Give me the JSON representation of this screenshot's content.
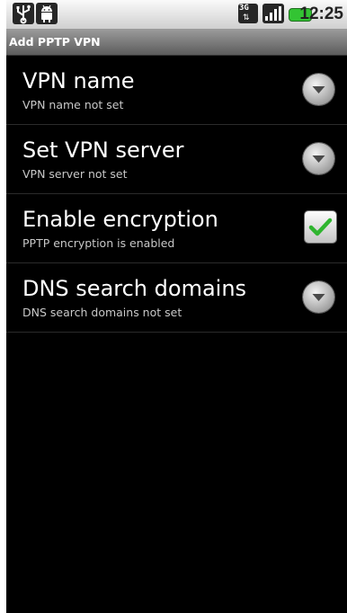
{
  "status_bar": {
    "time": "12:25",
    "network_type": "3G",
    "signal_bars": 4,
    "battery_color": "#33c433",
    "icons": [
      "usb-icon",
      "android-notification-icon",
      "3g-data-icon",
      "signal-strength-icon",
      "battery-icon"
    ]
  },
  "title_bar": {
    "title": "Add PPTP VPN"
  },
  "preferences": [
    {
      "title": "VPN name",
      "summary": "VPN name not set",
      "widget": "dropdown-arrow-icon"
    },
    {
      "title": "Set VPN server",
      "summary": "VPN server not set",
      "widget": "dropdown-arrow-icon"
    },
    {
      "title": "Enable encryption",
      "summary": "PPTP encryption is enabled",
      "widget": "checkbox",
      "checked": true
    },
    {
      "title": "DNS search domains",
      "summary": "DNS search domains not set",
      "widget": "dropdown-arrow-icon"
    }
  ],
  "colors": {
    "background": "#000000",
    "check_mark": "#2fb52f",
    "summary_text": "#c8c8c8"
  }
}
